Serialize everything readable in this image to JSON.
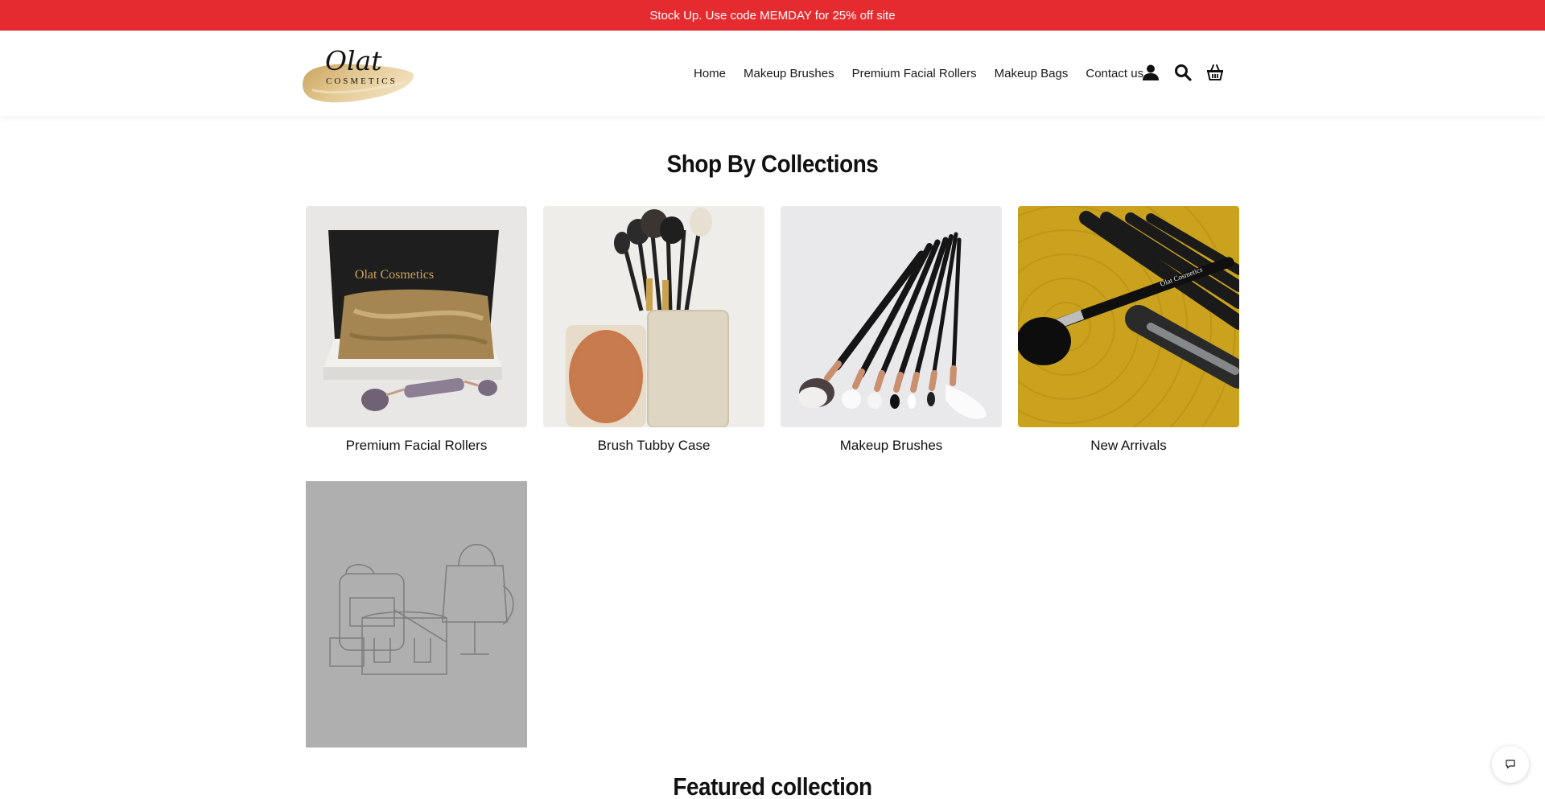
{
  "announcement": {
    "text": "Stock Up. Use code MEMDAY for 25% off site"
  },
  "logo": {
    "script_text": "Olat",
    "sub_text": "COSMETICS"
  },
  "nav": {
    "links": [
      "Home",
      "Makeup Brushes",
      "Premium Facial Rollers",
      "Makeup Bags",
      "Contact us"
    ],
    "icons": [
      "account-icon",
      "search-icon",
      "cart-basket-icon"
    ]
  },
  "collections": {
    "title": "Shop By Collections",
    "items": [
      {
        "label": "Premium Facial Rollers",
        "image_text": "Olat Cosmetics"
      },
      {
        "label": "Brush Tubby Case"
      },
      {
        "label": "Makeup Brushes"
      },
      {
        "label": "New Arrivals",
        "image_text": "Olat Cosmetics"
      }
    ],
    "placeholder_icon": "bags-illustration"
  },
  "featured": {
    "title": "Featured collection"
  },
  "chat": {
    "icon": "chat-bubble-icon"
  },
  "colors": {
    "announcement_bg": "#e52b2f",
    "placeholder_bg": "#afafaf",
    "logo_gold": "#d8b97e"
  }
}
